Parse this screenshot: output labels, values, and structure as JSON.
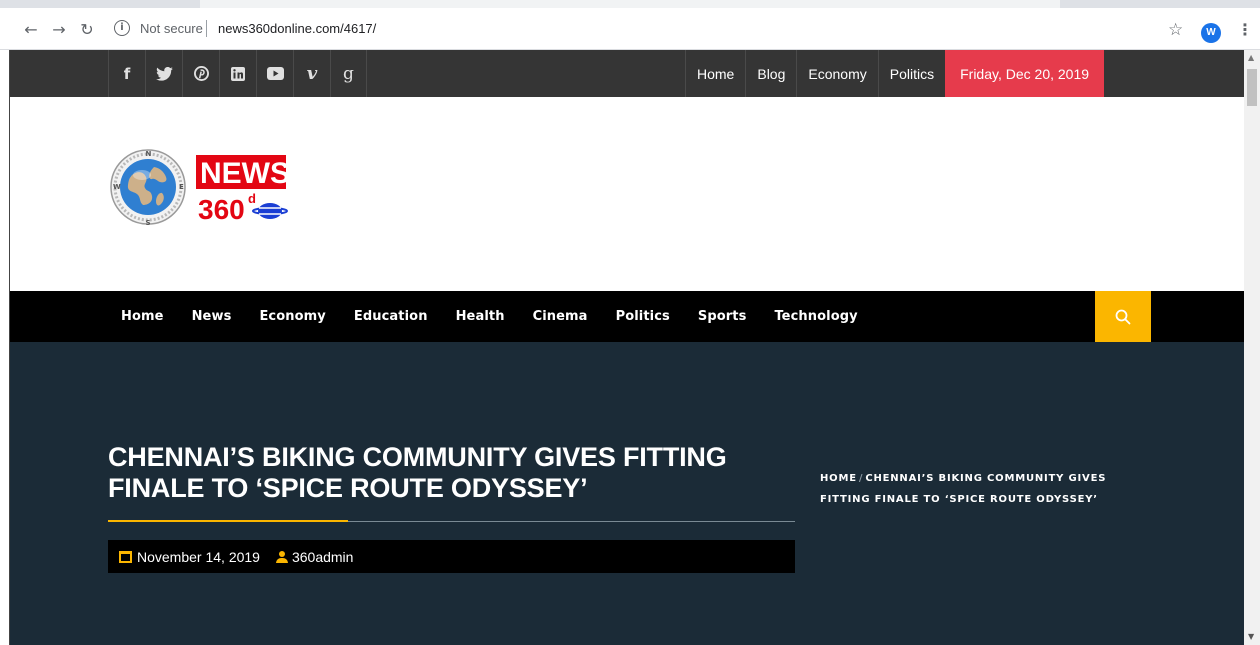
{
  "browser": {
    "security_label": "Not secure",
    "url": "news360donline.com/4617/",
    "profile_initial": "W"
  },
  "social_icons": [
    {
      "name": "facebook-icon",
      "glyph": "f"
    },
    {
      "name": "twitter-icon",
      "glyph": "🐦"
    },
    {
      "name": "pinterest-icon",
      "glyph": "℗"
    },
    {
      "name": "linkedin-icon",
      "glyph": "in"
    },
    {
      "name": "youtube-icon",
      "glyph": "▶"
    },
    {
      "name": "vimeo-icon",
      "glyph": "v"
    },
    {
      "name": "google-plus-icon",
      "glyph": "g"
    }
  ],
  "topnav": {
    "items": [
      "Home",
      "Blog",
      "Economy",
      "Politics"
    ],
    "date": "Friday, Dec 20, 2019"
  },
  "logo": {
    "word1": "NEWS",
    "word2": "360",
    "superscript": "d"
  },
  "mainnav": {
    "items": [
      "Home",
      "News",
      "Economy",
      "Education",
      "Health",
      "Cinema",
      "Politics",
      "Sports",
      "Technology"
    ]
  },
  "article": {
    "title": "Chennai’s Biking Community Gives Fitting Finale to ‘Spice Route Odyssey’",
    "date": "November 14, 2019",
    "author": "360admin"
  },
  "breadcrumb": {
    "home": "Home",
    "separator": "/",
    "current": "Chennai’s Biking Community Gives Fitting Finale to ‘Spice Route Odyssey’"
  },
  "colors": {
    "topbar": "#353535",
    "date_badge": "#e63b4c",
    "accent": "#fbb600",
    "hero": "#1b2b37"
  }
}
